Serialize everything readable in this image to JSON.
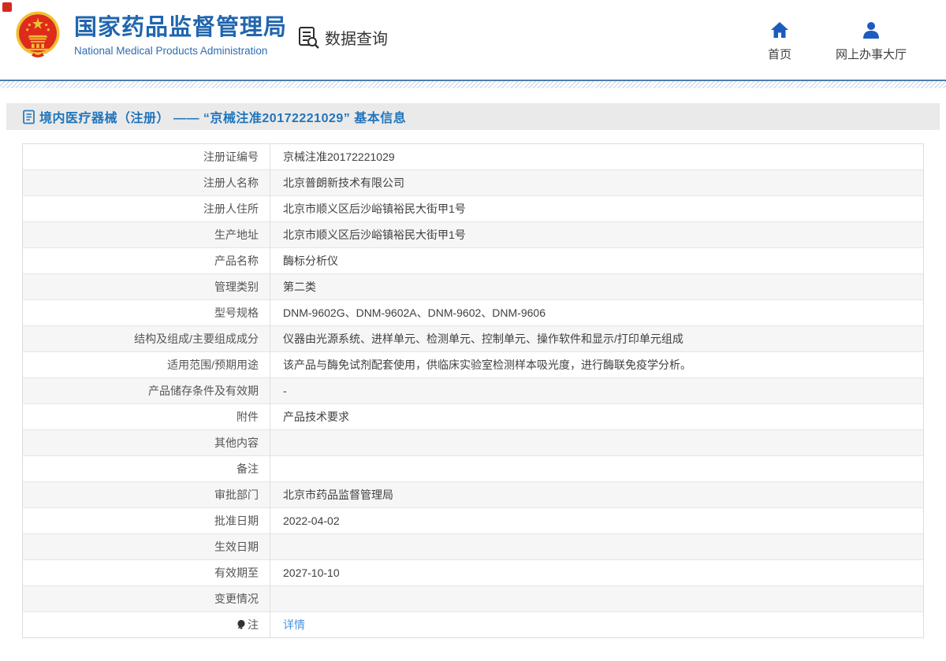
{
  "header": {
    "brand_cn": "国家药品监督管理局",
    "brand_en": "National Medical Products Administration",
    "data_query_label": "数据查询",
    "nav": [
      {
        "label": "首页",
        "icon": "home-icon"
      },
      {
        "label": "网上办事大厅",
        "icon": "user-icon"
      }
    ]
  },
  "page": {
    "title": "境内医疗器械（注册） —— “京械注准20172221029” 基本信息"
  },
  "detail_table": {
    "rows": [
      {
        "label": "注册证编号",
        "value": "京械注准20172221029"
      },
      {
        "label": "注册人名称",
        "value": "北京普朗新技术有限公司"
      },
      {
        "label": "注册人住所",
        "value": "北京市顺义区后沙峪镇裕民大街甲1号"
      },
      {
        "label": "生产地址",
        "value": "北京市顺义区后沙峪镇裕民大街甲1号"
      },
      {
        "label": "产品名称",
        "value": "酶标分析仪"
      },
      {
        "label": "管理类别",
        "value": "第二类"
      },
      {
        "label": "型号规格",
        "value": "DNM-9602G、DNM-9602A、DNM-9602、DNM-9606"
      },
      {
        "label": "结构及组成/主要组成成分",
        "value": "仪器由光源系统、进样单元、检测单元、控制单元、操作软件和显示/打印单元组成"
      },
      {
        "label": "适用范围/预期用途",
        "value": "该产品与酶免试剂配套使用，供临床实验室检测样本吸光度，进行酶联免疫学分析。"
      },
      {
        "label": "产品储存条件及有效期",
        "value": "-"
      },
      {
        "label": "附件",
        "value": "产品技术要求"
      },
      {
        "label": "其他内容",
        "value": ""
      },
      {
        "label": "备注",
        "value": ""
      },
      {
        "label": "审批部门",
        "value": "北京市药品监督管理局"
      },
      {
        "label": "批准日期",
        "value": "2022-04-02"
      },
      {
        "label": "生效日期",
        "value": ""
      },
      {
        "label": "有效期至",
        "value": "2027-10-10"
      },
      {
        "label": "变更情况",
        "value": ""
      },
      {
        "label": "注",
        "value": "详情",
        "label_icon": "bulb-icon",
        "value_is_link": true
      }
    ]
  },
  "colors": {
    "brand_blue": "#2166ae",
    "title_blue": "#2175bc",
    "link_blue": "#4694e0",
    "nav_icon_blue": "#1d5cbf",
    "emblem_red": "#de2b1c",
    "emblem_gold": "#f0bf32",
    "row_alt_gray": "#f6f6f6"
  }
}
